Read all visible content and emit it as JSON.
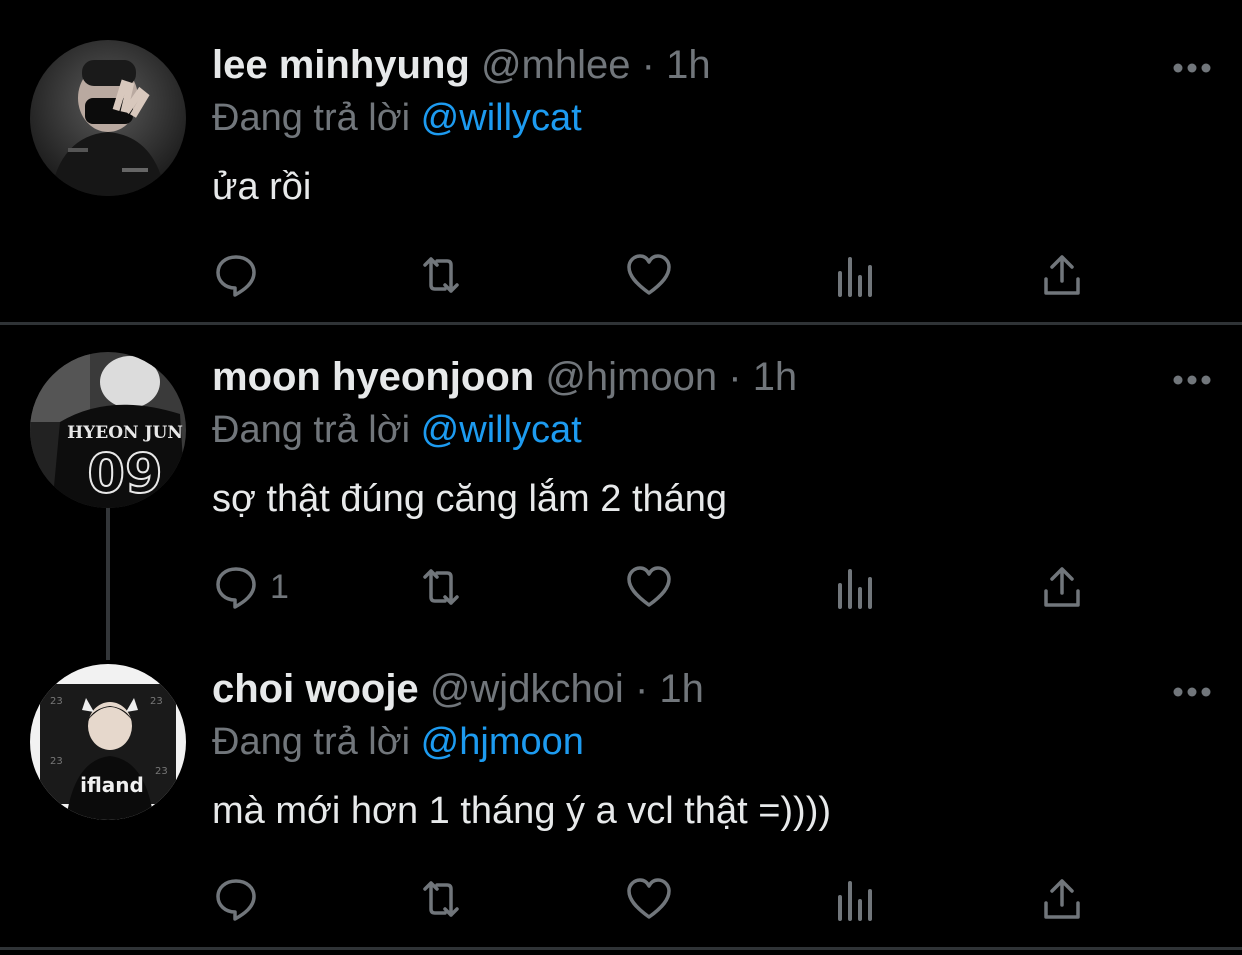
{
  "tweets": [
    {
      "name": "lee minhyung",
      "handle": "@mhlee",
      "sep": "·",
      "time": "1h",
      "reply_prefix": "Đang trả lời",
      "reply_to": "@willycat",
      "text": "ửa rồi",
      "reply_count": ""
    },
    {
      "name": "moon hyeonjoon",
      "handle": "@hjmoon",
      "sep": "·",
      "time": "1h",
      "reply_prefix": "Đang trả lời",
      "reply_to": "@willycat",
      "text": "sợ thật đúng căng lắm 2 tháng",
      "reply_count": "1",
      "avatar_jersey_text": "HYEON JUN",
      "avatar_jersey_number": "09"
    },
    {
      "name": "choi wooje",
      "handle": "@wjdkchoi",
      "sep": "·",
      "time": "1h",
      "reply_prefix": "Đang trả lời",
      "reply_to": "@hjmoon",
      "text": "mà mới hơn 1 tháng ý a vcl thật =))))",
      "reply_count": "",
      "avatar_shirt_text": "ifland"
    }
  ],
  "icons": {
    "reply": "speech-bubble-icon",
    "retweet": "retweet-icon",
    "like": "heart-icon",
    "views": "bar-chart-icon",
    "share": "share-icon",
    "more": "more-dots-icon"
  },
  "colors": {
    "background": "#000000",
    "text": "#e7e9ea",
    "muted": "#71767b",
    "accent": "#1d9bf0",
    "divider": "#2f3336"
  }
}
